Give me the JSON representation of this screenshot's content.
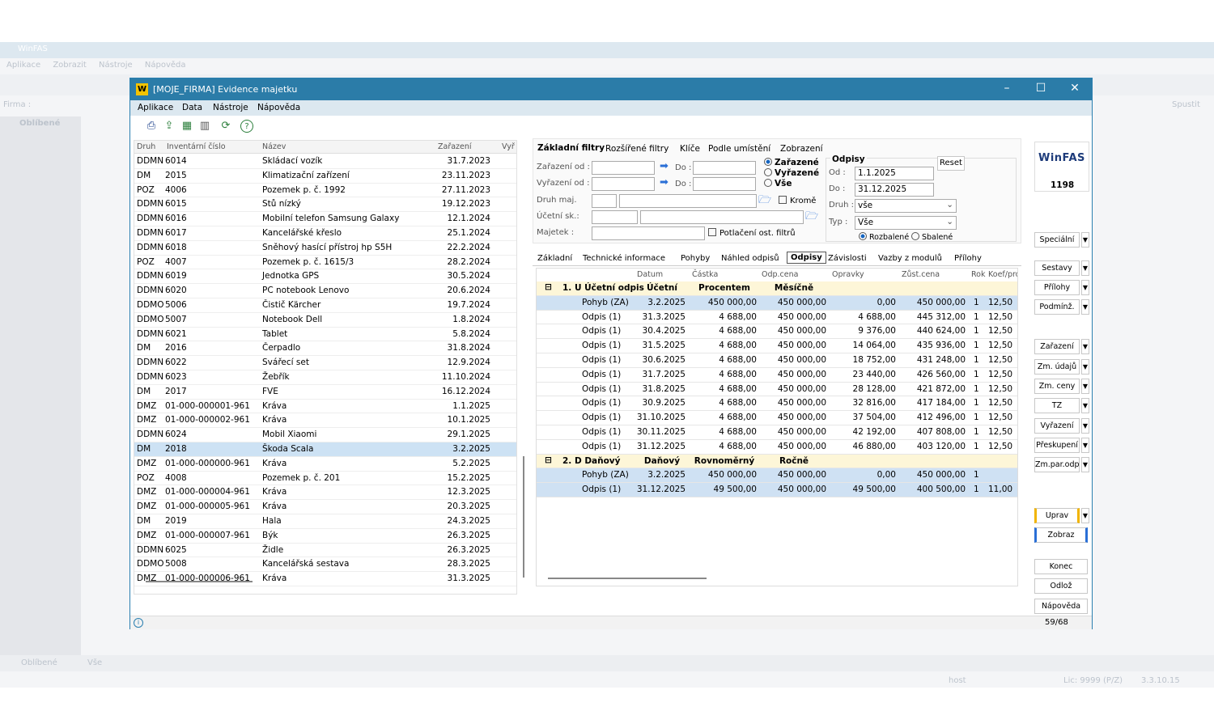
{
  "bg": {
    "title": "WinFAS",
    "menu": [
      "Aplikace",
      "Zobrazit",
      "Nástroje",
      "Nápověda"
    ],
    "firma_label": "Firma :",
    "spustit": "Spustit",
    "oblibene_header": "Oblíbené",
    "bottom_tabs": [
      "Oblíbené",
      "Vše"
    ],
    "status_host": "host",
    "status_lic": "Lic: 9999 (P/Z)",
    "status_ver": "3.3.10.15"
  },
  "window": {
    "title": "[MOJE_FIRMA] Evidence majetku",
    "menu": [
      "Aplikace",
      "Data",
      "Nástroje",
      "Nápověda"
    ]
  },
  "list": {
    "headers": [
      "Druh",
      "Inventární číslo",
      "Název",
      "Zařazení",
      "Vyř"
    ],
    "rows": [
      [
        "DDMN",
        "6014",
        "Skládací vozík",
        "31.7.2023"
      ],
      [
        "DM",
        "2015",
        "Klimatizační zařízení",
        "23.11.2023"
      ],
      [
        "POZ",
        "4006",
        "Pozemek p. č. 1992",
        "27.11.2023"
      ],
      [
        "DDMN",
        "6015",
        "Stů nízký",
        "19.12.2023"
      ],
      [
        "DDMN",
        "6016",
        "Mobilní telefon Samsung Galaxy",
        "12.1.2024"
      ],
      [
        "DDMN",
        "6017",
        "Kancelářské křeslo",
        "25.1.2024"
      ],
      [
        "DDMN",
        "6018",
        "Sněhový hasící přístroj hp S5H",
        "22.2.2024"
      ],
      [
        "POZ",
        "4007",
        "Pozemek p. č. 1615/3",
        "28.2.2024"
      ],
      [
        "DDMN",
        "6019",
        "Jednotka GPS",
        "30.5.2024"
      ],
      [
        "DDMN",
        "6020",
        "PC notebook Lenovo",
        "20.6.2024"
      ],
      [
        "DDMO",
        "5006",
        "Čistič Kärcher",
        "19.7.2024"
      ],
      [
        "DDMO",
        "5007",
        "Notebook Dell",
        "1.8.2024"
      ],
      [
        "DDMN",
        "6021",
        "Tablet",
        "5.8.2024"
      ],
      [
        "DM",
        "2016",
        "Čerpadlo",
        "31.8.2024"
      ],
      [
        "DDMN",
        "6022",
        "Svářecí set",
        "12.9.2024"
      ],
      [
        "DDMN",
        "6023",
        "Žebřík",
        "11.10.2024"
      ],
      [
        "DM",
        "2017",
        "FVE",
        "16.12.2024"
      ],
      [
        "DMZ",
        "01-000-000001-961",
        "Kráva",
        "1.1.2025"
      ],
      [
        "DMZ",
        "01-000-000002-961",
        "Kráva",
        "10.1.2025"
      ],
      [
        "DDMN",
        "6024",
        "Mobil Xiaomi",
        "29.1.2025"
      ],
      [
        "DM",
        "2018",
        "Škoda Scala",
        "3.2.2025"
      ],
      [
        "DMZ",
        "01-000-000000-961",
        "Kráva",
        "5.2.2025"
      ],
      [
        "POZ",
        "4008",
        "Pozemek p. č. 201",
        "15.2.2025"
      ],
      [
        "DMZ",
        "01-000-000004-961",
        "Kráva",
        "12.3.2025"
      ],
      [
        "DMZ",
        "01-000-000005-961",
        "Kráva",
        "20.3.2025"
      ],
      [
        "DM",
        "2019",
        "Hala",
        "24.3.2025"
      ],
      [
        "DMZ",
        "01-000-000007-961",
        "Býk",
        "26.3.2025"
      ],
      [
        "DDMN",
        "6025",
        "Židle",
        "26.3.2025"
      ],
      [
        "DDMO",
        "5008",
        "Kancelářská sestava",
        "28.3.2025"
      ],
      [
        "DMZ",
        "01-000-000006-961",
        "Kráva",
        "31.3.2025"
      ]
    ]
  },
  "filters": {
    "tabs": [
      "Základní filtry",
      "Rozšířené filtry",
      "Klíče",
      "Podle umístění",
      "Zobrazení"
    ],
    "zarazeni_od": "Zařazení od :",
    "vyrazeni_od": "Vyřazení od :",
    "do": "Do :",
    "druh_maj": "Druh maj.",
    "ucetni_sk": "Účetní sk.:",
    "majetek": "Majetek :",
    "radio_zarazene": "Zařazené",
    "radio_vyrazene": "Vyřazené",
    "radio_vse": "Vše",
    "krome": "Kromě",
    "potlaceni": "Potlačení ost. filtrů",
    "odpisy_title": "Odpisy",
    "reset": "Reset",
    "od_label": "Od :",
    "od_value": "1.1.2025",
    "do_label": "Do :",
    "do_value": "31.12.2025",
    "druh_label": "Druh :",
    "druh_value": "vše",
    "typ_label": "Typ :",
    "typ_value": "Vše",
    "rozbalene": "Rozbalené",
    "sbalene": "Sbalené"
  },
  "detail_tabs": [
    "Základní",
    "Technické informace",
    "Pohyby",
    "Náhled odpisů",
    "Odpisy",
    "Závislosti",
    "Vazby z modulů",
    "Přílohy"
  ],
  "grid": {
    "headers": [
      "Datum",
      "Částka",
      "Odp.cena",
      "Opravky",
      "Zůst.cena",
      "Rok",
      "Koef/pro"
    ],
    "group1": [
      "1. U Účetní odpis",
      "Účetní",
      "Procentem",
      "Měsíčně"
    ],
    "rows1": [
      [
        "Pohyb (ZA)",
        "3.2.2025",
        "450 000,00",
        "450 000,00",
        "0,00",
        "450 000,00",
        "1",
        "12,50"
      ],
      [
        "Odpis (1)",
        "31.3.2025",
        "4 688,00",
        "450 000,00",
        "4 688,00",
        "445 312,00",
        "1",
        "12,50"
      ],
      [
        "Odpis (1)",
        "30.4.2025",
        "4 688,00",
        "450 000,00",
        "9 376,00",
        "440 624,00",
        "1",
        "12,50"
      ],
      [
        "Odpis (1)",
        "31.5.2025",
        "4 688,00",
        "450 000,00",
        "14 064,00",
        "435 936,00",
        "1",
        "12,50"
      ],
      [
        "Odpis (1)",
        "30.6.2025",
        "4 688,00",
        "450 000,00",
        "18 752,00",
        "431 248,00",
        "1",
        "12,50"
      ],
      [
        "Odpis (1)",
        "31.7.2025",
        "4 688,00",
        "450 000,00",
        "23 440,00",
        "426 560,00",
        "1",
        "12,50"
      ],
      [
        "Odpis (1)",
        "31.8.2025",
        "4 688,00",
        "450 000,00",
        "28 128,00",
        "421 872,00",
        "1",
        "12,50"
      ],
      [
        "Odpis (1)",
        "30.9.2025",
        "4 688,00",
        "450 000,00",
        "32 816,00",
        "417 184,00",
        "1",
        "12,50"
      ],
      [
        "Odpis (1)",
        "31.10.2025",
        "4 688,00",
        "450 000,00",
        "37 504,00",
        "412 496,00",
        "1",
        "12,50"
      ],
      [
        "Odpis (1)",
        "30.11.2025",
        "4 688,00",
        "450 000,00",
        "42 192,00",
        "407 808,00",
        "1",
        "12,50"
      ],
      [
        "Odpis (1)",
        "31.12.2025",
        "4 688,00",
        "450 000,00",
        "46 880,00",
        "403 120,00",
        "1",
        "12,50"
      ]
    ],
    "group2": [
      "2. D Daňový",
      "Daňový",
      "Rovnoměrný",
      "Ročně"
    ],
    "rows2": [
      [
        "Pohyb (ZA)",
        "3.2.2025",
        "450 000,00",
        "450 000,00",
        "0,00",
        "450 000,00",
        "1",
        ""
      ],
      [
        "Odpis (1)",
        "31.12.2025",
        "49 500,00",
        "450 000,00",
        "49 500,00",
        "400 500,00",
        "1",
        "11,00"
      ]
    ]
  },
  "sidebar": {
    "logo": "WinFAS",
    "number": "1198",
    "buttons": [
      "Speciální",
      "Sestavy",
      "Přílohy",
      "Podmínž.",
      "Zařazení",
      "Zm. údajů",
      "Zm. ceny",
      "TZ",
      "Vyřazení",
      "Přeskupení",
      "Zm.par.odp",
      "Uprav",
      "Zobraz",
      "Konec",
      "Odlož",
      "Nápověda"
    ]
  },
  "status": {
    "count": "59/68"
  }
}
